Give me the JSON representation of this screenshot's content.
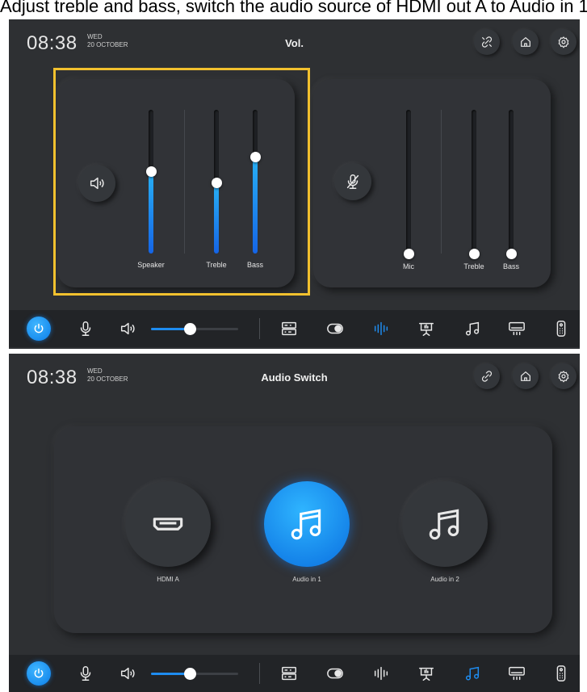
{
  "caption": "Adjust treble and bass, switch the audio source of HDMI out A to Audio in 1",
  "colors": {
    "accent": "#1e8cf0",
    "highlight": "#f2c12e",
    "background": "#2e3033",
    "bar": "#222427"
  },
  "screen1": {
    "time": "08:38",
    "day": "WED",
    "date": "20 OCTOBER",
    "title": "Vol.",
    "top_icons": [
      "unlink-icon",
      "home-icon",
      "gear-icon"
    ],
    "speaker_panel": {
      "icon": "speaker-icon",
      "sliders": [
        {
          "label": "Speaker",
          "level": 0.57
        },
        {
          "label": "Treble",
          "level": 0.49
        },
        {
          "label": "Bass",
          "level": 0.67
        }
      ]
    },
    "mic_panel": {
      "icon": "mic-muted-icon",
      "sliders": [
        {
          "label": "Mic",
          "level": 0.0
        },
        {
          "label": "Treble",
          "level": 0.0
        },
        {
          "label": "Bass",
          "level": 0.0
        }
      ]
    }
  },
  "screen2": {
    "time": "08:38",
    "day": "WED",
    "date": "20 OCTOBER",
    "title": "Audio Switch",
    "top_icons": [
      "unlink-icon",
      "home-icon",
      "gear-icon"
    ],
    "sources": [
      {
        "label": "HDMI A",
        "icon": "hdmi-icon",
        "active": false
      },
      {
        "label": "Audio in 1",
        "icon": "music-note-icon",
        "active": true
      },
      {
        "label": "Audio in 2",
        "icon": "music-note-icon",
        "active": false
      }
    ]
  },
  "bottom_bar": {
    "volume_level": 0.45,
    "icons": [
      "power-icon",
      "mic-icon",
      "speaker-icon",
      "matrix-switcher-icon",
      "toggle-icon",
      "audio-levels-icon",
      "projector-icon",
      "music-icon",
      "air-conditioner-icon",
      "remote-icon"
    ]
  }
}
